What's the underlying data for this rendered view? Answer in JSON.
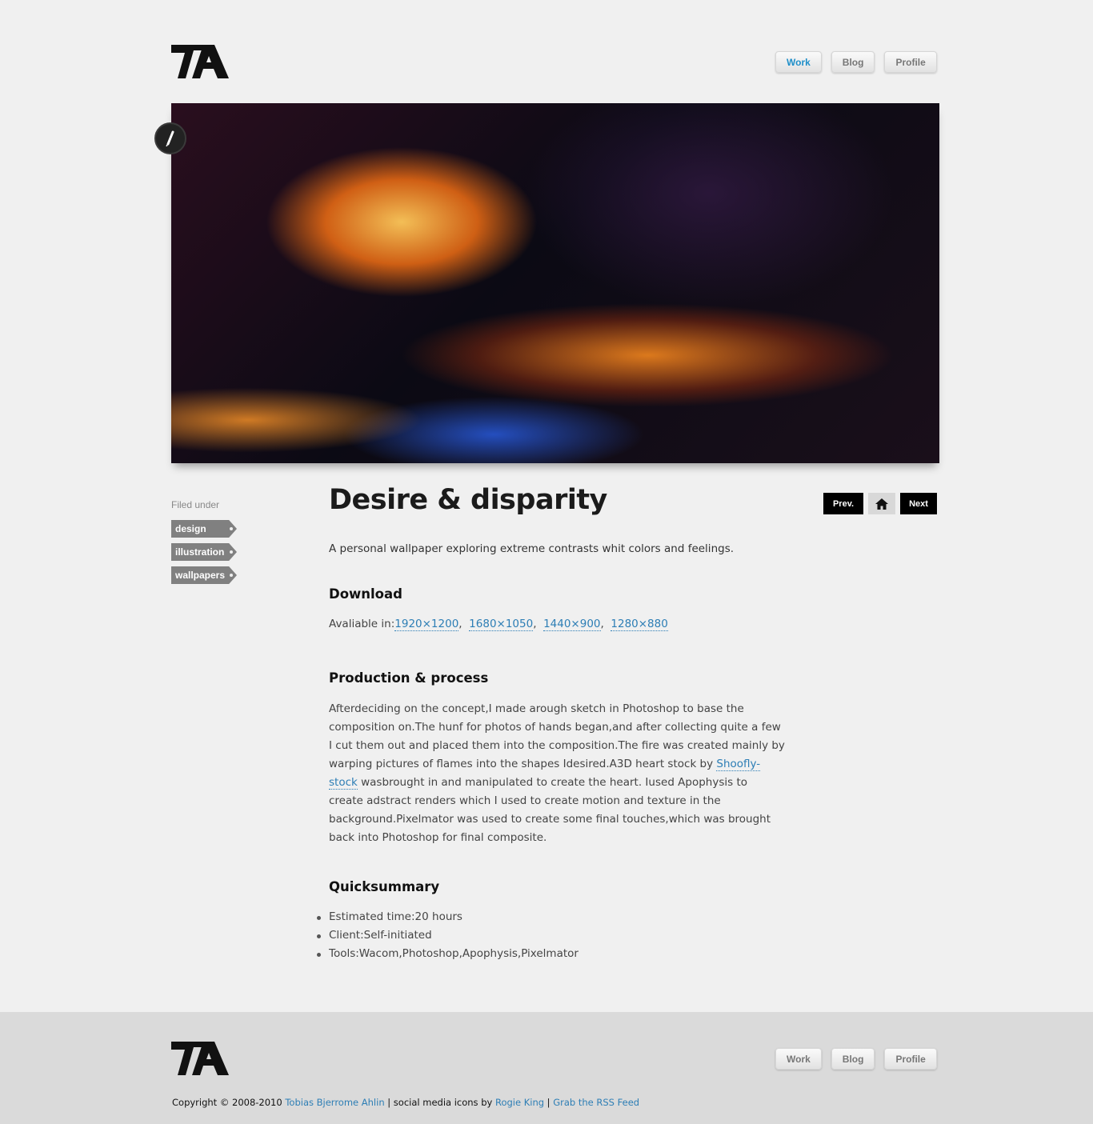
{
  "header": {
    "nav": [
      {
        "label": "Work",
        "active": true
      },
      {
        "label": "Blog",
        "active": false
      },
      {
        "label": "Profile",
        "active": false
      }
    ]
  },
  "sidebar": {
    "filed_label": "Filed under",
    "tags": [
      "design",
      "illustration",
      "wallpapers"
    ]
  },
  "pager": {
    "prev": "Prev.",
    "next": "Next"
  },
  "article": {
    "title": "Desire & disparity",
    "intro": "A personal wallpaper exploring extreme contrasts whit colors and feelings.",
    "download_heading": "Download",
    "download_prefix": "Avaliable in:",
    "resolutions": [
      "1920×1200",
      "1680×1050",
      "1440×900",
      "1280×880"
    ],
    "process_heading": "Production & process",
    "process_before_link": "Afterdeciding on the concept,I made arough sketch in Photoshop to base the composition on.The hunf for photos of hands began,and after collecting quite a few I cut them out and placed them into the composition.The fire was created mainly by warping pictures of flames into the shapes Idesired.A3D heart stock by ",
    "process_link": "Shoofly-stock",
    "process_after_link": " wasbrought in and manipulated to create the heart. Iused Apophysis to create adstract renders which I used to create motion and texture in the background.Pixelmator was used to create some final touches,which was brought back into Photoshop for final composite.",
    "summary_heading": "Quicksummary",
    "summary": [
      "Estimated time:20 hours",
      "Client:Self-initiated",
      "Tools:Wacom,Photoshop,Apophysis,Pixelmator"
    ]
  },
  "footer": {
    "nav": [
      {
        "label": "Work"
      },
      {
        "label": "Blog"
      },
      {
        "label": "Profile"
      }
    ],
    "copyright_prefix": "Copyright © 2008-2010 ",
    "author": "Tobias Bjerrome Ahlin",
    "icons_text": " | social media icons by ",
    "icons_author": "Rogie King",
    "sep": " | ",
    "rss": "Grab the RSS Feed"
  },
  "icons": {
    "logo": "ta-logo",
    "badge": "pencil-icon",
    "home": "home-icon"
  }
}
